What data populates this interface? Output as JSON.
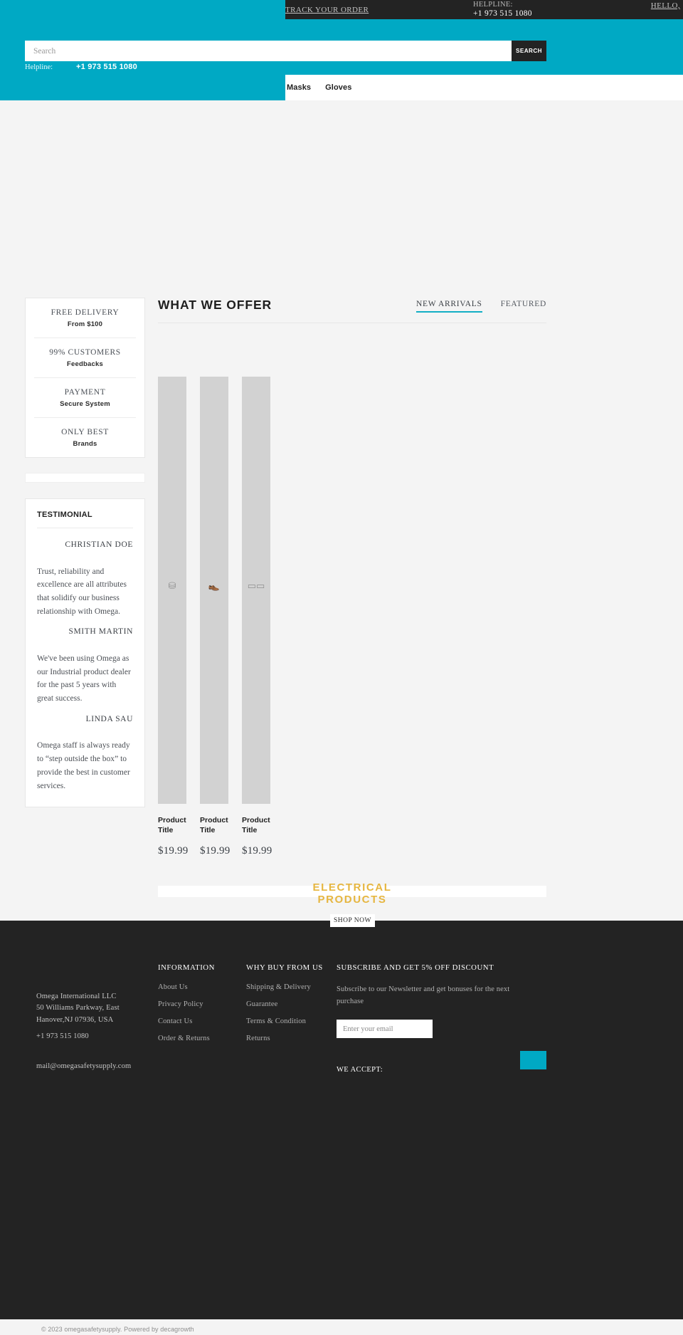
{
  "topbar": {
    "track_order": "TRACK YOUR ORDER",
    "helpline_label": "HELPLINE:",
    "helpline_number": "+1 973 515 1080",
    "hello": "HELLO,"
  },
  "header": {
    "search_placeholder": "Search",
    "search_button": "SEARCH",
    "helpline_label": "Helpline:",
    "helpline_number": "+1 973 515 1080"
  },
  "nav": {
    "items": [
      {
        "label": "Masks"
      },
      {
        "label": "Gloves"
      }
    ]
  },
  "features": [
    {
      "title": "FREE DELIVERY",
      "sub": "From $100"
    },
    {
      "title": "99% CUSTOMERS",
      "sub": "Feedbacks"
    },
    {
      "title": "PAYMENT",
      "sub": "Secure System"
    },
    {
      "title": "ONLY BEST",
      "sub": "Brands"
    }
  ],
  "testimonials": {
    "title": "TESTIMONIAL",
    "items": [
      {
        "name": "CHRISTIAN DOE",
        "text": "Trust, reliability and excellence are all attributes that solidify our business relationship with Omega."
      },
      {
        "name": "SMITH MARTIN",
        "text": "We've been using Omega as our Industrial product dealer for the past 5 years with great success."
      },
      {
        "name": "LINDA SAU",
        "text": "Omega staff is always ready to “step outside the box” to provide the best in customer services."
      }
    ]
  },
  "offer": {
    "title": "WHAT WE OFFER",
    "tabs": [
      {
        "label": "NEW ARRIVALS",
        "active": true
      },
      {
        "label": "FEATURED",
        "active": false
      }
    ],
    "products": [
      {
        "title": "Product Title",
        "price": "$19.99",
        "icon": "bag-icon",
        "glyph": "⛁"
      },
      {
        "title": "Product Title",
        "price": "$19.99",
        "icon": "shoe-icon",
        "glyph": "👞"
      },
      {
        "title": "Product Title",
        "price": "$19.99",
        "icon": "goggles-icon",
        "glyph": "▭▭"
      }
    ]
  },
  "promo": {
    "line1": "ELECTRICAL",
    "line2": "PRODUCTS",
    "button": "SHOP NOW",
    "accent_color": "#e6b640"
  },
  "footer": {
    "company_address": "Omega International LLC\n50 Williams Parkway, East\nHanover,NJ 07936, USA",
    "phone": "+1 973 515 1080",
    "email": "mail@omegasafetysupply.com",
    "columns": [
      {
        "heading": "INFORMATION",
        "links": [
          {
            "label": "About Us"
          },
          {
            "label": "Privacy Policy"
          },
          {
            "label": "Contact Us"
          },
          {
            "label": "Order & Returns"
          }
        ]
      },
      {
        "heading": "WHY BUY FROM US",
        "links": [
          {
            "label": "Shipping & Delivery"
          },
          {
            "label": "Guarantee"
          },
          {
            "label": "Terms & Condition"
          },
          {
            "label": "Returns"
          }
        ]
      }
    ],
    "subscribe": {
      "heading": "SUBSCRIBE AND GET 5% OFF DISCOUNT",
      "description": "Subscribe to our Newsletter and get bonuses for the next purchase",
      "placeholder": "Enter your email",
      "button_icon": "send-icon",
      "button_color": "#00a9c4"
    },
    "we_accept": "WE ACCEPT:",
    "copyright": "© 2023 omegasafetysupply. Powered by decagrowth"
  },
  "colors": {
    "teal": "#00a9c4",
    "dark": "#232323",
    "page_bg": "#f4f4f4"
  }
}
